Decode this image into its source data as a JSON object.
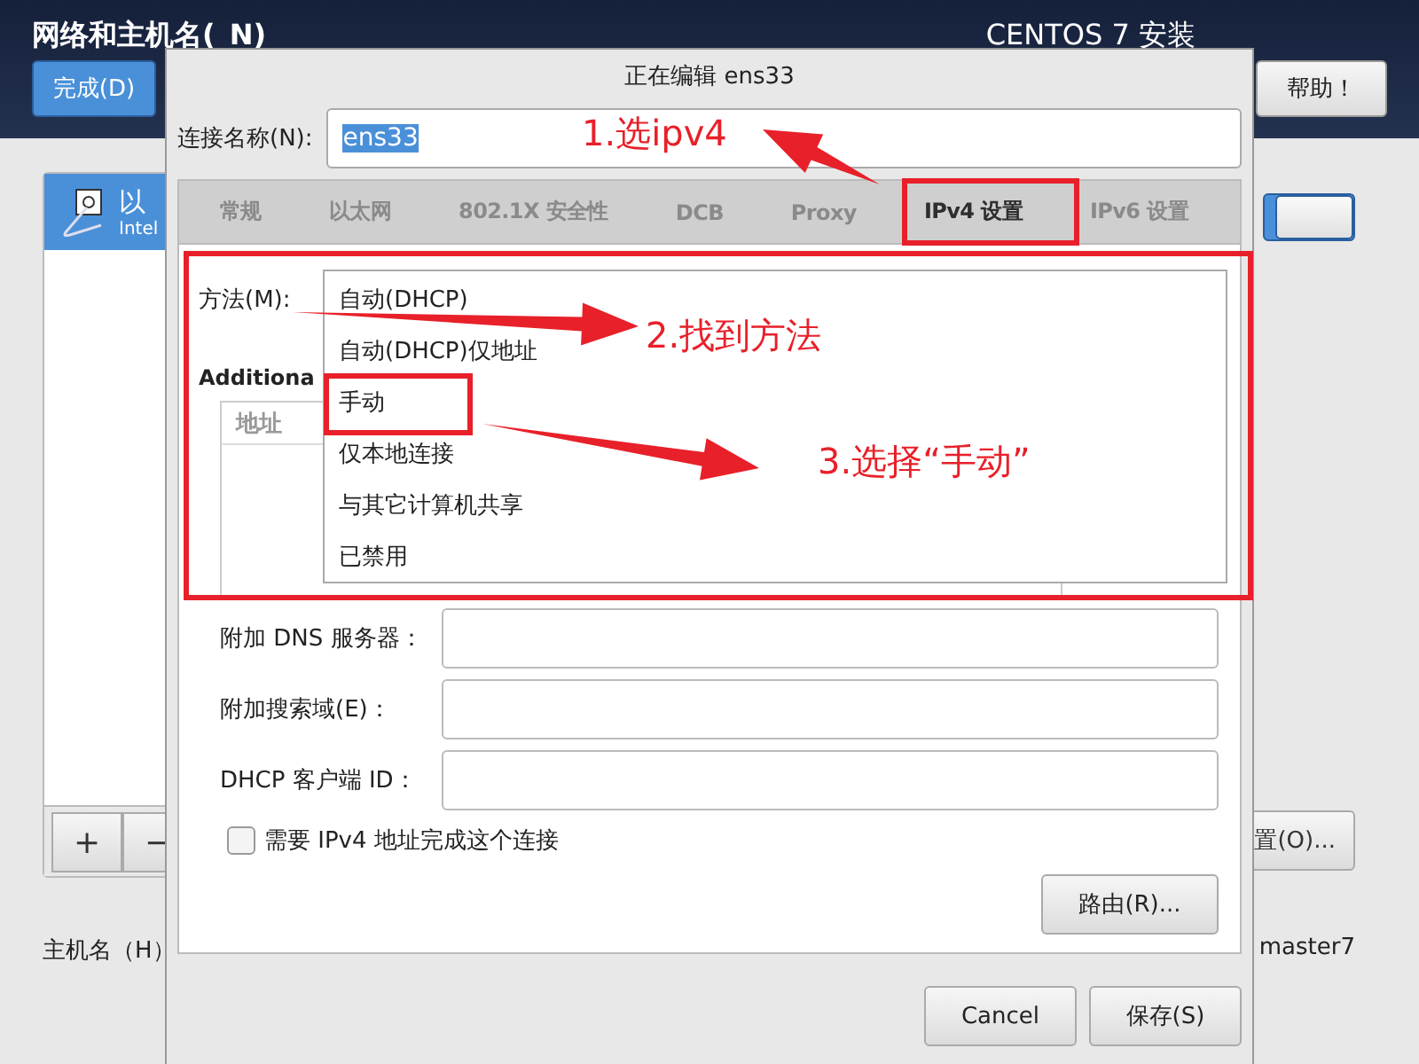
{
  "installer": {
    "title": "网络和主机名(_N)",
    "product": "CENTOS 7 安装",
    "done_button": "完成(D)",
    "help_button": "帮助！"
  },
  "device_list": {
    "items": [
      {
        "name": "以",
        "detail": "Intel",
        "selected": true
      }
    ],
    "add_button": "+",
    "remove_button": "−"
  },
  "device_switch": {
    "on": true
  },
  "configure_button": "置(O)...",
  "hostname": {
    "label": "主机名（H）",
    "current": "master7"
  },
  "dialog": {
    "title": "正在编辑 ens33",
    "connection_name_label": "连接名称(N):",
    "connection_name": "ens33",
    "tabs": [
      {
        "label": "常规",
        "selected": false
      },
      {
        "label": "以太网",
        "selected": false
      },
      {
        "label": "802.1X 安全性",
        "selected": false
      },
      {
        "label": "DCB",
        "selected": false
      },
      {
        "label": "Proxy",
        "selected": false
      },
      {
        "label": "IPv4 设置",
        "selected": true
      },
      {
        "label": "IPv6 设置",
        "selected": false
      }
    ],
    "method_label": "方法(M):",
    "method_options": [
      "自动(DHCP)",
      "自动(DHCP)仅地址",
      "手动",
      "仅本地连接",
      "与其它计算机共享",
      "已禁用"
    ],
    "additional_heading": "Additiona",
    "address_columns": [
      "地址"
    ],
    "fields": [
      {
        "label": "附加 DNS 服务器："
      },
      {
        "label": "附加搜索域(E)："
      },
      {
        "label": "DHCP 客户端 ID："
      }
    ],
    "require_ipv4": {
      "label": "需要 IPv4 地址完成这个连接",
      "checked": false
    },
    "routes_button": "路由(R)...",
    "buttons": [
      "Cancel",
      "保存(S)"
    ]
  },
  "annotations": [
    {
      "text": "1.选ipv4"
    },
    {
      "text": "2.找到方法"
    },
    {
      "text": "3.选择“手动”"
    }
  ]
}
